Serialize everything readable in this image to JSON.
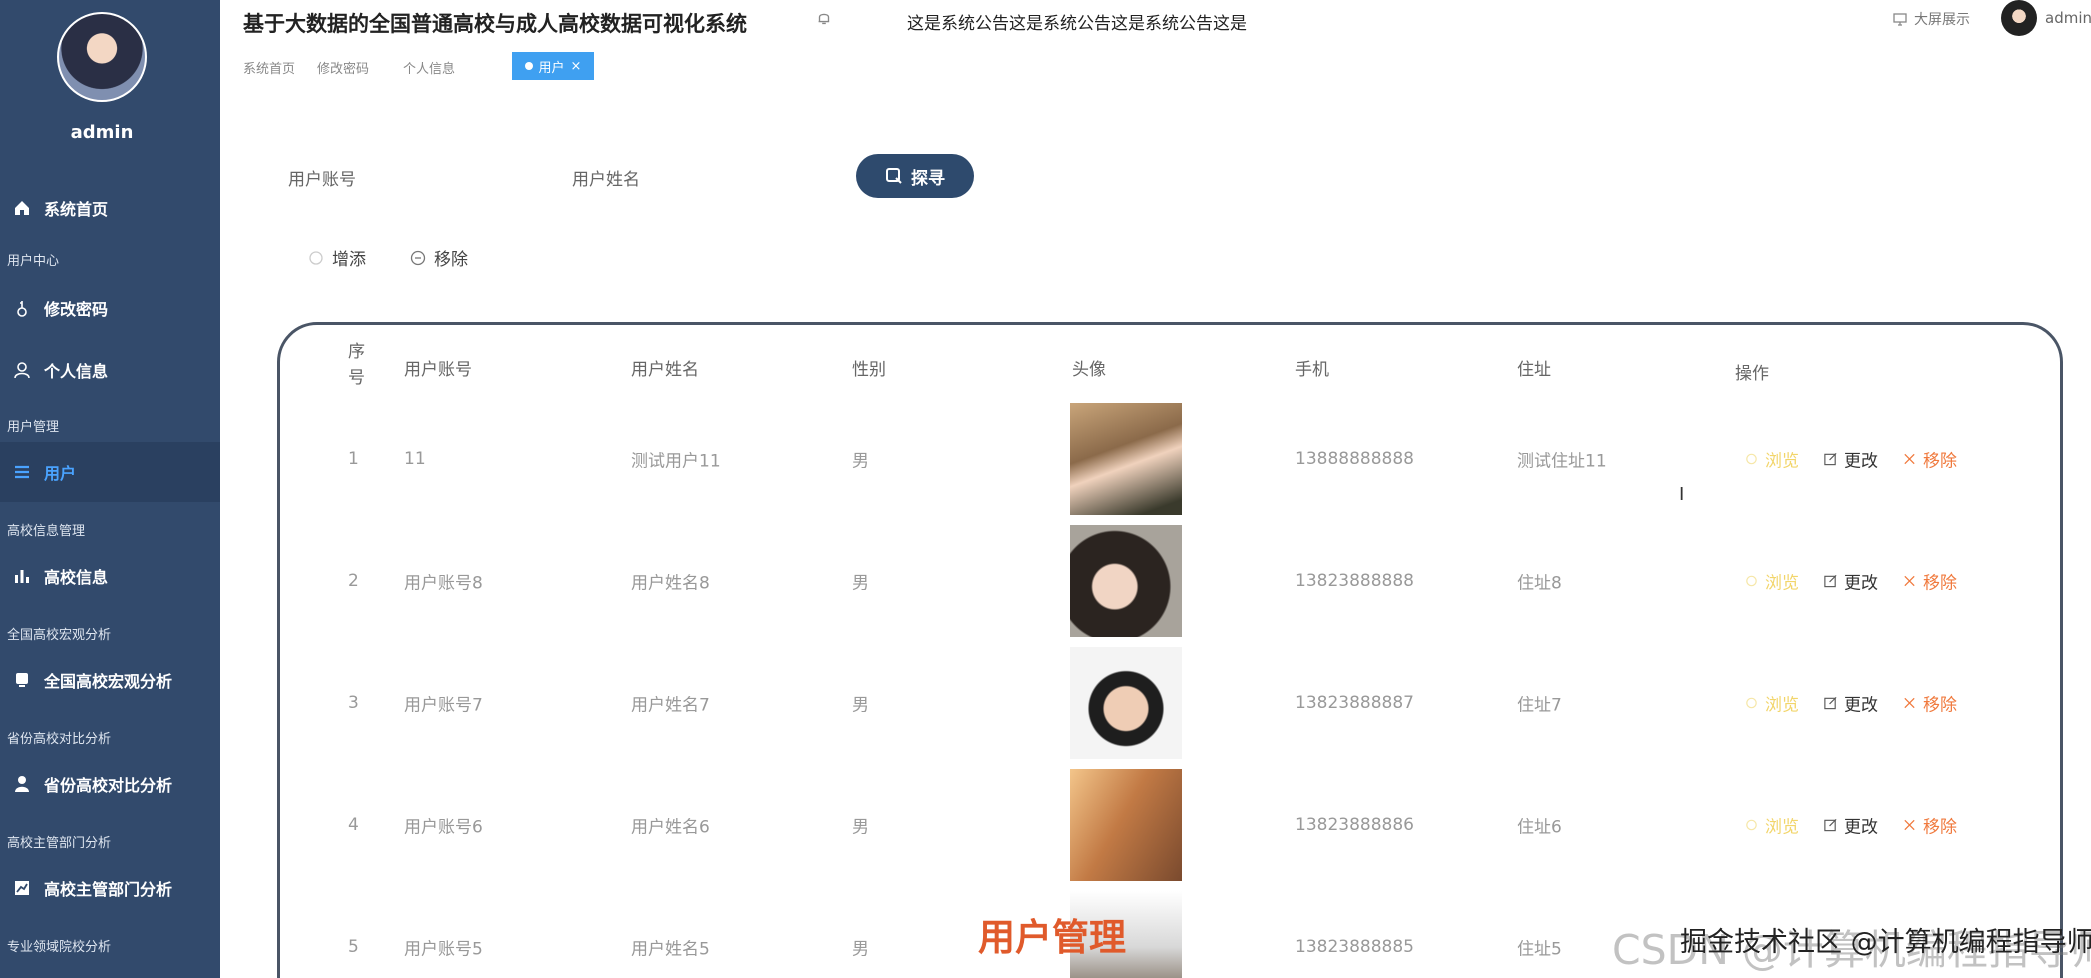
{
  "sidebar": {
    "username": "admin",
    "items": [
      {
        "label": "系统首页",
        "icon": "home-icon"
      },
      {
        "group": "用户中心"
      },
      {
        "label": "修改密码",
        "icon": "key-icon"
      },
      {
        "label": "个人信息",
        "icon": "user-icon"
      },
      {
        "group": "用户管理"
      },
      {
        "label": "用户",
        "icon": "list-icon",
        "active": true
      },
      {
        "group": "高校信息管理"
      },
      {
        "label": "高校信息",
        "icon": "bar-chart-icon"
      },
      {
        "group": "全国高校宏观分析"
      },
      {
        "label": "全国高校宏观分析",
        "icon": "monitor-icon"
      },
      {
        "group": "省份高校对比分析"
      },
      {
        "label": "省份高校对比分析",
        "icon": "person-icon"
      },
      {
        "group": "高校主管部门分析"
      },
      {
        "label": "高校主管部门分析",
        "icon": "trend-icon"
      },
      {
        "group": "专业领域院校分析"
      }
    ]
  },
  "header": {
    "title": "基于大数据的全国普通高校与成人高校数据可视化系统",
    "notice": "这是系统公告这是系统公告这是系统公告这是",
    "screen_link": "大屏展示",
    "user": "admin"
  },
  "breadcrumbs": [
    "系统首页",
    "修改密码",
    "个人信息"
  ],
  "active_tab": {
    "label": "用户",
    "close": "×"
  },
  "search": {
    "account_label": "用户账号",
    "name_label": "用户姓名",
    "button": "探寻"
  },
  "actions": {
    "add": "增添",
    "remove": "移除"
  },
  "table": {
    "headers": [
      "序号",
      "用户账号",
      "用户姓名",
      "性别",
      "头像",
      "手机",
      "住址",
      "操作"
    ],
    "rows": [
      {
        "no": "1",
        "account": "11",
        "name": "测试用户11",
        "gender": "男",
        "phone": "13888888888",
        "address": "测试住址11"
      },
      {
        "no": "2",
        "account": "用户账号8",
        "name": "用户姓名8",
        "gender": "男",
        "phone": "13823888888",
        "address": "住址8"
      },
      {
        "no": "3",
        "account": "用户账号7",
        "name": "用户姓名7",
        "gender": "男",
        "phone": "13823888887",
        "address": "住址7"
      },
      {
        "no": "4",
        "account": "用户账号6",
        "name": "用户姓名6",
        "gender": "男",
        "phone": "13823888886",
        "address": "住址6"
      },
      {
        "no": "5",
        "account": "用户账号5",
        "name": "用户姓名5",
        "gender": "男",
        "phone": "13823888885",
        "address": "住址5"
      }
    ],
    "ops": {
      "view": "浏览",
      "edit": "更改",
      "delete": "移除"
    }
  },
  "overlay": {
    "caption": "用户管理",
    "watermark": "CSDN @计算机编程指导师",
    "watermark2": "掘金技术社区 @计算机编程指导师"
  },
  "colors": {
    "sidebar": "#324a6c",
    "accent": "#3fa0f1",
    "button": "#2e4a6d",
    "view": "#f2d56a",
    "delete": "#f07a3e"
  }
}
